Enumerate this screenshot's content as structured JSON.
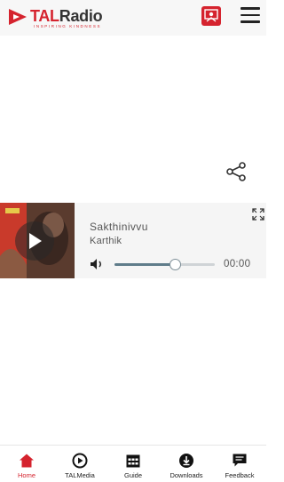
{
  "header": {
    "logo_text_prefix": "TAL",
    "logo_text_suffix": "Radio",
    "logo_tagline": "INSPIRING KINDNESS",
    "accent": "#d5232e",
    "icons": {
      "badge": "tal-badge-icon",
      "menu": "hamburger-menu-icon"
    }
  },
  "actions": {
    "share_icon": "share-icon",
    "expand_icon": "fullscreen-icon"
  },
  "player": {
    "track_title": "Sakthinivvu",
    "artist": "Karthik",
    "time": "00:00",
    "progress_fraction": 0.6,
    "icons": {
      "play": "play-icon",
      "volume": "volume-icon"
    }
  },
  "tabs": [
    {
      "label": "Home",
      "icon": "home-icon",
      "active": true
    },
    {
      "label": "TALMedia",
      "icon": "play-circle-icon",
      "active": false
    },
    {
      "label": "Guide",
      "icon": "calendar-icon",
      "active": false
    },
    {
      "label": "Downloads",
      "icon": "download-icon",
      "active": false
    },
    {
      "label": "Feedback",
      "icon": "feedback-icon",
      "active": false
    }
  ]
}
